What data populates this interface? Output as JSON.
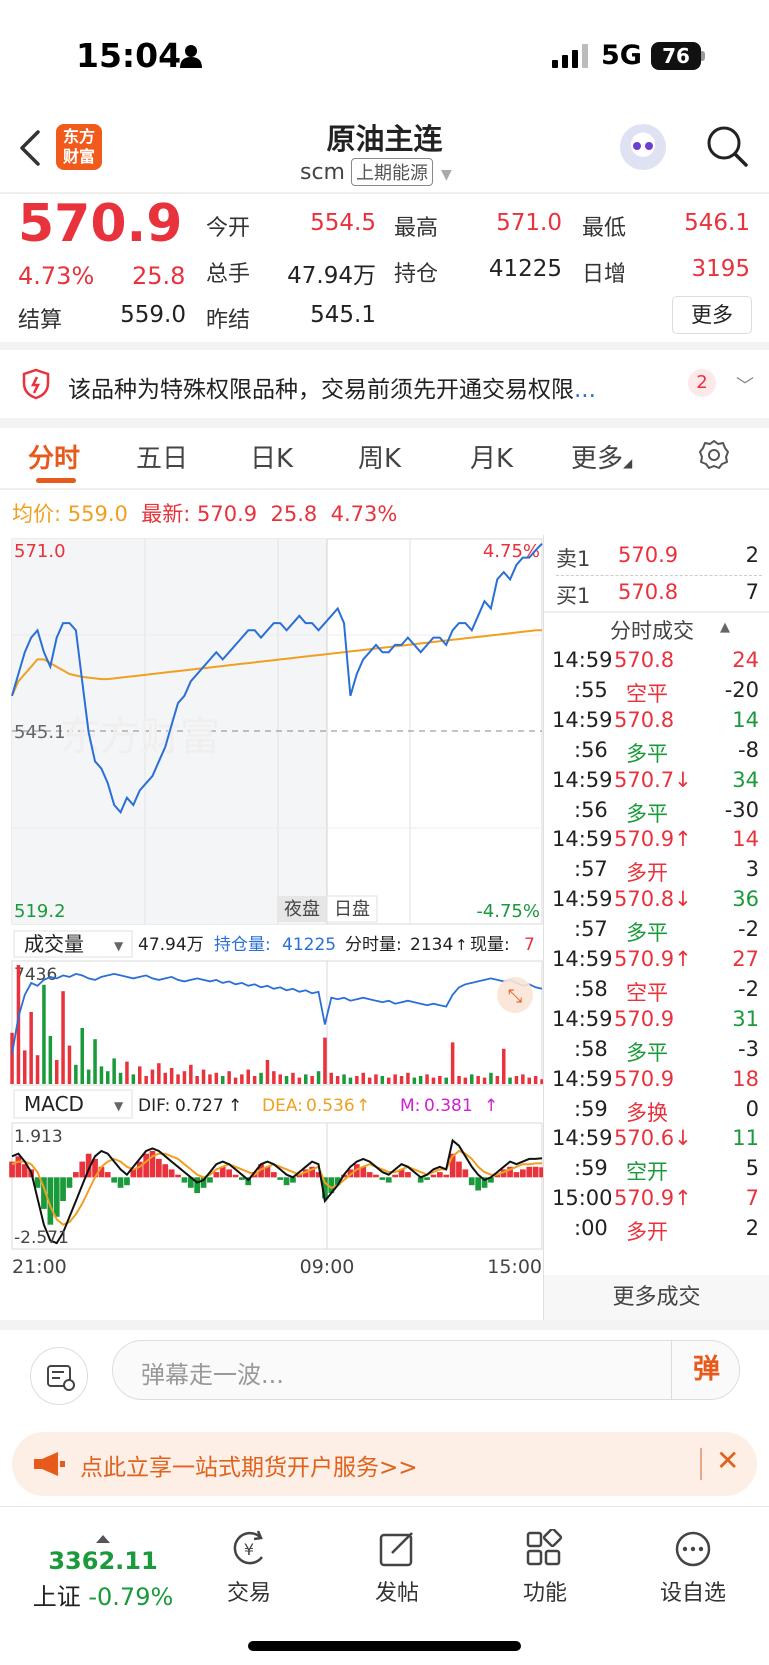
{
  "status_bar": {
    "time": "15:04",
    "network": "5G",
    "battery": "76"
  },
  "header": {
    "title": "原油主连",
    "code": "scm",
    "exchange": "上期能源",
    "logo_text": "东方财富"
  },
  "quote": {
    "price": "570.9",
    "change_pct": "4.73%",
    "change": "25.8",
    "fields": [
      {
        "label": "今开",
        "value": "554.5",
        "color": "#e8323c"
      },
      {
        "label": "最高",
        "value": "571.0",
        "color": "#e8323c"
      },
      {
        "label": "最低",
        "value": "546.1",
        "color": "#e8323c"
      },
      {
        "label": "总手",
        "value": "47.94万",
        "color": "#222222"
      },
      {
        "label": "持仓",
        "value": "41225",
        "color": "#222222"
      },
      {
        "label": "日增",
        "value": "3195",
        "color": "#e8323c"
      },
      {
        "label": "结算",
        "value": "559.0",
        "color": "#222222"
      },
      {
        "label": "昨结",
        "value": "545.1",
        "color": "#222222"
      }
    ],
    "more_label": "更多"
  },
  "notice": {
    "text": "该品种为特殊权限品种，交易前须先开通交易权限",
    "ellipsis": "...",
    "badge": "2"
  },
  "tabs": [
    "分时",
    "五日",
    "日K",
    "周K",
    "月K",
    "更多"
  ],
  "avg_row": {
    "avg_label": "均价:",
    "avg_value": "559.0",
    "latest_label": "最新:",
    "latest_value": "570.9",
    "latest_change": "25.8",
    "latest_pct": "4.73%"
  },
  "chart_data": [
    {
      "type": "line",
      "name": "intraday",
      "y_top_label": "571.0",
      "y_mid_label": "545.1",
      "y_bottom_label": "519.2",
      "pct_top_label": "4.75%",
      "pct_bottom_label": "-4.75%",
      "ylim": [
        519.2,
        571.0
      ],
      "reference": 545.1,
      "session_labels": [
        "夜盘",
        "日盘"
      ],
      "x_ticks": [
        "21:00",
        "09:00",
        "15:00"
      ],
      "price": [
        550,
        553,
        556,
        558,
        559,
        556,
        554,
        558,
        560,
        560,
        559,
        552,
        545,
        541,
        540,
        538,
        535,
        534,
        536,
        535,
        537,
        538,
        539,
        541,
        543,
        546,
        549,
        550,
        552,
        553,
        554,
        555,
        556,
        555,
        556,
        557,
        558,
        559,
        559,
        558,
        559,
        560,
        560,
        559,
        560,
        561,
        560,
        560,
        559,
        560,
        561,
        562,
        560,
        550,
        553,
        555,
        556,
        557,
        556,
        556,
        557,
        557,
        558,
        557,
        556,
        557,
        558,
        558,
        557,
        559,
        560,
        560,
        559,
        561,
        563,
        562,
        566,
        567,
        566,
        568,
        569,
        569,
        570,
        570.9
      ],
      "avg": [
        550,
        552,
        553,
        554,
        555,
        555,
        554.5,
        554,
        553.5,
        553,
        552.8,
        552.6,
        552.5,
        552.4,
        552.3,
        552.3,
        552.4,
        552.5,
        552.6,
        552.7,
        552.8,
        552.9,
        553,
        553.1,
        553.2,
        553.3,
        553.4,
        553.5,
        553.6,
        553.7,
        553.8,
        553.9,
        554,
        554.1,
        554.2,
        554.3,
        554.4,
        554.5,
        554.6,
        554.7,
        554.8,
        554.9,
        555,
        555.1,
        555.2,
        555.3,
        555.4,
        555.5,
        555.6,
        555.7,
        555.8,
        555.9,
        556,
        556.1,
        556.2,
        556.3,
        556.4,
        556.5,
        556.6,
        556.7,
        556.8,
        556.9,
        557,
        557.1,
        557.2,
        557.3,
        557.4,
        557.5,
        557.6,
        557.7,
        557.8,
        557.9,
        558,
        558.1,
        558.2,
        558.3,
        558.4,
        558.5,
        558.6,
        558.7,
        558.8,
        558.9,
        559,
        559.0
      ]
    },
    {
      "type": "bar",
      "name": "volume",
      "selector_label": "成交量",
      "total": "47.94万",
      "oi_label": "持仓量:",
      "oi_value": "41225",
      "min_vol_label": "分时量:",
      "min_vol_value": "2134",
      "now_vol_label": "现量:",
      "now_vol_value": "7",
      "y_max_label": "7436",
      "values": [
        3200,
        7436,
        2100,
        4500,
        1800,
        6200,
        3000,
        1500,
        5800,
        2400,
        1200,
        3500,
        900,
        2800,
        1100,
        800,
        1600,
        700,
        1400,
        600,
        1100,
        500,
        900,
        1300,
        700,
        1000,
        600,
        800,
        1200,
        500,
        900,
        600,
        700,
        500,
        800,
        400,
        600,
        900,
        500,
        700,
        1500,
        800,
        600,
        500,
        700,
        400,
        600,
        500,
        800,
        2900,
        700,
        500,
        600,
        400,
        500,
        700,
        400,
        600,
        500,
        400,
        600,
        500,
        700,
        400,
        500,
        600,
        400,
        500,
        400,
        2600,
        500,
        400,
        600,
        500,
        400,
        700,
        500,
        2200,
        400,
        500,
        600,
        400,
        500,
        300
      ],
      "oi": [
        20,
        45,
        60,
        68,
        66,
        70,
        72,
        71,
        73,
        72,
        74,
        73,
        71,
        70,
        72,
        73,
        74,
        73,
        72,
        71,
        72,
        73,
        71,
        70,
        71,
        72,
        70,
        69,
        70,
        71,
        70,
        69,
        70,
        68,
        69,
        67,
        68,
        66,
        67,
        65,
        66,
        64,
        65,
        63,
        64,
        62,
        63,
        61,
        62,
        40,
        58,
        57,
        58,
        56,
        57,
        58,
        57,
        56,
        55,
        56,
        54,
        55,
        56,
        55,
        54,
        53,
        54,
        53,
        52,
        60,
        65,
        67,
        68,
        69,
        70,
        71,
        70,
        69,
        70,
        68,
        66,
        67,
        65,
        64
      ]
    },
    {
      "type": "bar",
      "name": "macd",
      "selector_label": "MACD",
      "dif_label": "DIF:",
      "dif_value": "0.727",
      "dea_label": "DEA:",
      "dea_value": "0.536",
      "m_label": "M:",
      "m_value": "0.381",
      "y_max_label": "1.913",
      "y_min_label": "-2.571",
      "ylim": [
        -2.571,
        1.913
      ],
      "hist": [
        0.6,
        0.8,
        0.5,
        0.3,
        -0.4,
        -1.2,
        -1.8,
        -1.5,
        -0.9,
        -0.4,
        0.2,
        0.6,
        0.9,
        0.7,
        0.4,
        0.2,
        -0.2,
        -0.4,
        -0.3,
        0.3,
        0.6,
        0.9,
        1.0,
        0.7,
        0.5,
        0.3,
        0.1,
        -0.2,
        -0.4,
        -0.6,
        -0.4,
        -0.2,
        0.2,
        0.4,
        0.3,
        0.1,
        -0.1,
        -0.3,
        0.2,
        0.5,
        0.4,
        0.2,
        -0.1,
        -0.3,
        -0.2,
        0.1,
        0.3,
        0.4,
        0.2,
        -0.8,
        -0.6,
        -0.3,
        0.1,
        0.3,
        0.5,
        0.4,
        0.2,
        0.1,
        -0.1,
        -0.2,
        0.1,
        0.3,
        0.2,
        0.0,
        -0.2,
        -0.1,
        0.1,
        0.2,
        0.1,
        0.9,
        0.6,
        0.3,
        -0.3,
        -0.5,
        -0.4,
        -0.2,
        0.1,
        0.3,
        0.4,
        0.2,
        0.3,
        0.4,
        0.4,
        0.38
      ],
      "dif": [
        0.8,
        0.9,
        0.6,
        0.2,
        -0.8,
        -1.8,
        -2.4,
        -2.5,
        -2.1,
        -1.5,
        -0.9,
        -0.3,
        0.3,
        0.8,
        1.0,
        0.9,
        0.6,
        0.3,
        0.1,
        0.4,
        0.7,
        1.0,
        1.1,
        1.0,
        0.8,
        0.6,
        0.4,
        0.2,
        0.0,
        -0.2,
        -0.1,
        0.2,
        0.5,
        0.6,
        0.5,
        0.3,
        0.1,
        -0.1,
        0.2,
        0.5,
        0.6,
        0.5,
        0.3,
        0.1,
        0.0,
        0.2,
        0.4,
        0.6,
        0.5,
        -0.9,
        -0.6,
        -0.3,
        0.1,
        0.4,
        0.6,
        0.7,
        0.6,
        0.4,
        0.2,
        0.1,
        0.3,
        0.5,
        0.4,
        0.2,
        0.0,
        0.1,
        0.3,
        0.4,
        0.3,
        1.4,
        1.2,
        0.8,
        0.4,
        0.1,
        -0.1,
        0.0,
        0.2,
        0.4,
        0.6,
        0.5,
        0.6,
        0.7,
        0.7,
        0.727
      ],
      "dea": [
        0.5,
        0.6,
        0.6,
        0.5,
        0.2,
        -0.4,
        -1.1,
        -1.6,
        -1.8,
        -1.7,
        -1.4,
        -1.0,
        -0.5,
        0.0,
        0.4,
        0.6,
        0.7,
        0.6,
        0.4,
        0.3,
        0.4,
        0.6,
        0.8,
        0.9,
        0.9,
        0.8,
        0.7,
        0.5,
        0.3,
        0.1,
        0.0,
        0.1,
        0.3,
        0.4,
        0.5,
        0.4,
        0.3,
        0.2,
        0.1,
        0.3,
        0.4,
        0.5,
        0.4,
        0.3,
        0.2,
        0.1,
        0.2,
        0.3,
        0.4,
        -0.2,
        -0.4,
        -0.3,
        -0.1,
        0.1,
        0.3,
        0.4,
        0.5,
        0.4,
        0.3,
        0.2,
        0.2,
        0.3,
        0.4,
        0.3,
        0.2,
        0.1,
        0.2,
        0.3,
        0.3,
        0.8,
        1.0,
        0.9,
        0.7,
        0.4,
        0.2,
        0.1,
        0.1,
        0.2,
        0.3,
        0.4,
        0.5,
        0.5,
        0.53,
        0.536
      ]
    }
  ],
  "order_book": {
    "ask": {
      "label": "卖1",
      "price": "570.9",
      "volume": "2"
    },
    "bid": {
      "label": "买1",
      "price": "570.8",
      "volume": "7"
    }
  },
  "trades": {
    "title": "分时成交",
    "rows": [
      {
        "time": "14:59",
        "price": "570.8",
        "arrow": "",
        "vol": "24",
        "pcolor": "#e8323c",
        "vcolor": "#e8323c"
      },
      {
        "time": ":55",
        "price": "空平",
        "arrow": "",
        "vol": "-20",
        "pcolor": "#e8323c",
        "vcolor": "#222222"
      },
      {
        "time": "14:59",
        "price": "570.8",
        "arrow": "",
        "vol": "14",
        "pcolor": "#e8323c",
        "vcolor": "#1a9a3a"
      },
      {
        "time": ":56",
        "price": "多平",
        "arrow": "",
        "vol": "-8",
        "pcolor": "#1a9a3a",
        "vcolor": "#222222"
      },
      {
        "time": "14:59",
        "price": "570.7",
        "arrow": "↓",
        "vol": "34",
        "pcolor": "#e8323c",
        "vcolor": "#1a9a3a"
      },
      {
        "time": ":56",
        "price": "多平",
        "arrow": "",
        "vol": "-30",
        "pcolor": "#1a9a3a",
        "vcolor": "#222222"
      },
      {
        "time": "14:59",
        "price": "570.9",
        "arrow": "↑",
        "vol": "14",
        "pcolor": "#e8323c",
        "vcolor": "#e8323c"
      },
      {
        "time": ":57",
        "price": "多开",
        "arrow": "",
        "vol": "3",
        "pcolor": "#e8323c",
        "vcolor": "#222222"
      },
      {
        "time": "14:59",
        "price": "570.8",
        "arrow": "↓",
        "vol": "36",
        "pcolor": "#e8323c",
        "vcolor": "#1a9a3a"
      },
      {
        "time": ":57",
        "price": "多平",
        "arrow": "",
        "vol": "-2",
        "pcolor": "#1a9a3a",
        "vcolor": "#222222"
      },
      {
        "time": "14:59",
        "price": "570.9",
        "arrow": "↑",
        "vol": "27",
        "pcolor": "#e8323c",
        "vcolor": "#e8323c"
      },
      {
        "time": ":58",
        "price": "空平",
        "arrow": "",
        "vol": "-2",
        "pcolor": "#e8323c",
        "vcolor": "#222222"
      },
      {
        "time": "14:59",
        "price": "570.9",
        "arrow": "",
        "vol": "31",
        "pcolor": "#e8323c",
        "vcolor": "#1a9a3a"
      },
      {
        "time": ":58",
        "price": "多平",
        "arrow": "",
        "vol": "-3",
        "pcolor": "#1a9a3a",
        "vcolor": "#222222"
      },
      {
        "time": "14:59",
        "price": "570.9",
        "arrow": "",
        "vol": "18",
        "pcolor": "#e8323c",
        "vcolor": "#e8323c"
      },
      {
        "time": ":59",
        "price": "多换",
        "arrow": "",
        "vol": "0",
        "pcolor": "#e8323c",
        "vcolor": "#222222"
      },
      {
        "time": "14:59",
        "price": "570.6",
        "arrow": "↓",
        "vol": "11",
        "pcolor": "#e8323c",
        "vcolor": "#1a9a3a"
      },
      {
        "time": ":59",
        "price": "空开",
        "arrow": "",
        "vol": "5",
        "pcolor": "#1a9a3a",
        "vcolor": "#222222"
      },
      {
        "time": "15:00",
        "price": "570.9",
        "arrow": "↑",
        "vol": "7",
        "pcolor": "#e8323c",
        "vcolor": "#e8323c"
      },
      {
        "time": ":00",
        "price": "多开",
        "arrow": "",
        "vol": "2",
        "pcolor": "#e8323c",
        "vcolor": "#222222"
      }
    ],
    "more_label": "更多成交"
  },
  "danmaku": {
    "placeholder": "弹幕走一波...",
    "send_label": "弹"
  },
  "promo": {
    "text": "点此立享一站式期货开户服务>>"
  },
  "bottom_bar": {
    "index_value": "3362.11",
    "index_name": "上证",
    "index_change": "-0.79%",
    "items": [
      "交易",
      "发帖",
      "功能",
      "设自选"
    ]
  },
  "colors": {
    "up": "#e8323c",
    "down": "#1a9a3a",
    "accent": "#e85a1c",
    "price_line": "#2a6fd6",
    "avg_line": "#f0a020"
  }
}
